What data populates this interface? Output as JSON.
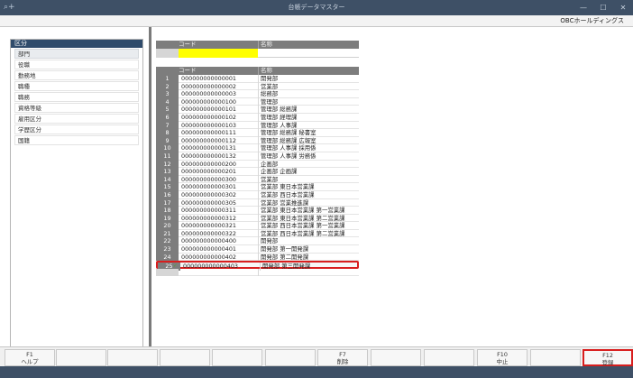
{
  "window": {
    "title": "台帳データマスター",
    "app_icon": "search-plus-icon",
    "controls": {
      "minimize": "—",
      "maximize": "☐",
      "close": "✕"
    }
  },
  "company": "OBCホールディングス",
  "left_panel": {
    "header": "区分",
    "items": [
      "部門",
      "役職",
      "勤務地",
      "職種",
      "職務",
      "資格等級",
      "雇用区分",
      "学歴区分",
      "国籍"
    ],
    "selected_index": 0
  },
  "top_grid": {
    "col_code": "コード",
    "col_name": "名称",
    "input_value": ""
  },
  "grid": {
    "col_code": "コード",
    "col_name": "名称",
    "rows": [
      {
        "no": "1",
        "code": "000000000000001",
        "name": "開発部"
      },
      {
        "no": "2",
        "code": "000000000000002",
        "name": "営業部"
      },
      {
        "no": "3",
        "code": "000000000000003",
        "name": "総務部"
      },
      {
        "no": "4",
        "code": "000000000000100",
        "name": "管理部"
      },
      {
        "no": "5",
        "code": "000000000000101",
        "name": "管理部 総務課"
      },
      {
        "no": "6",
        "code": "000000000000102",
        "name": "管理部 経理課"
      },
      {
        "no": "7",
        "code": "000000000000103",
        "name": "管理部 人事課"
      },
      {
        "no": "8",
        "code": "000000000000111",
        "name": "管理部 総務課 秘書室"
      },
      {
        "no": "9",
        "code": "000000000000112",
        "name": "管理部 総務課 広報室"
      },
      {
        "no": "10",
        "code": "000000000000131",
        "name": "管理部 人事課 採用係"
      },
      {
        "no": "11",
        "code": "000000000000132",
        "name": "管理部 人事課 労務係"
      },
      {
        "no": "12",
        "code": "000000000000200",
        "name": "企画部"
      },
      {
        "no": "13",
        "code": "000000000000201",
        "name": "企画部 企画課"
      },
      {
        "no": "14",
        "code": "000000000000300",
        "name": "営業部"
      },
      {
        "no": "15",
        "code": "000000000000301",
        "name": "営業部 東日本営業課"
      },
      {
        "no": "16",
        "code": "000000000000302",
        "name": "営業部 西日本営業課"
      },
      {
        "no": "17",
        "code": "000000000000305",
        "name": "営業部 営業推進課"
      },
      {
        "no": "18",
        "code": "000000000000311",
        "name": "営業部 東日本営業課 第一営業課"
      },
      {
        "no": "19",
        "code": "000000000000312",
        "name": "営業部 東日本営業課 第二営業課"
      },
      {
        "no": "20",
        "code": "000000000000321",
        "name": "営業部 西日本営業課 第一営業課"
      },
      {
        "no": "21",
        "code": "000000000000322",
        "name": "営業部 西日本営業課 第二営業課"
      },
      {
        "no": "22",
        "code": "000000000000400",
        "name": "開発部"
      },
      {
        "no": "23",
        "code": "000000000000401",
        "name": "開発部 第一開発課"
      },
      {
        "no": "24",
        "code": "000000000000402",
        "name": "開発部 第二開発課"
      },
      {
        "no": "25",
        "code": "000000000000403",
        "name": "開発部 第三開発課"
      }
    ],
    "active_row": 24,
    "active_mark": "✓"
  },
  "fkeys": [
    {
      "key": "F1",
      "label": "ヘルプ"
    },
    {
      "key": "",
      "label": ""
    },
    {
      "key": "",
      "label": ""
    },
    {
      "key": "",
      "label": ""
    },
    {
      "key": "",
      "label": ""
    },
    {
      "key": "",
      "label": ""
    },
    {
      "key": "F7",
      "label": "削除"
    },
    {
      "key": "",
      "label": ""
    },
    {
      "key": "",
      "label": ""
    },
    {
      "key": "F10",
      "label": "中止"
    },
    {
      "key": "",
      "label": ""
    },
    {
      "key": "F12",
      "label": "登録"
    }
  ],
  "colors": {
    "titlebar": "#3e5066",
    "highlight": "#d81e1e",
    "input_highlight": "#ffff00"
  }
}
